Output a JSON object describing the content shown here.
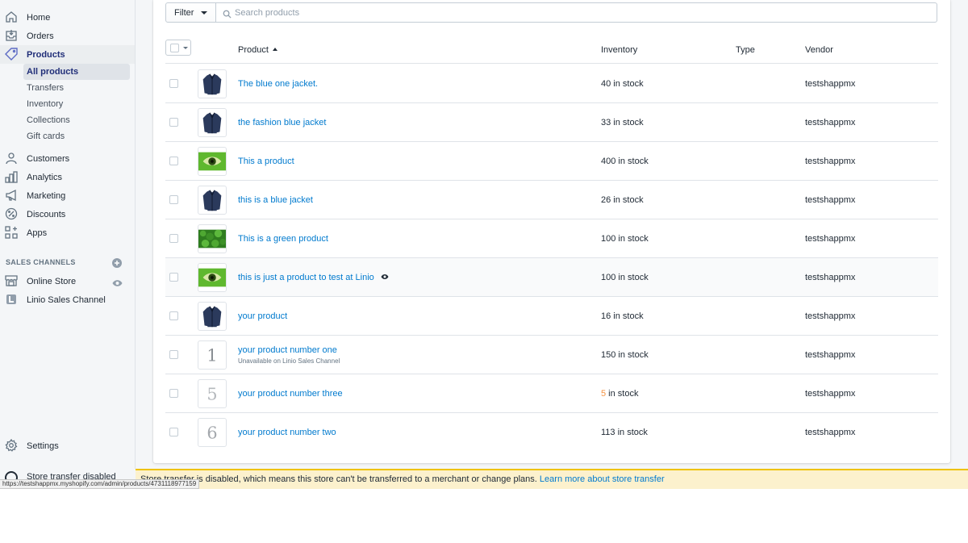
{
  "sidebar": {
    "nav": [
      {
        "label": "Home",
        "icon": "home-icon"
      },
      {
        "label": "Orders",
        "icon": "orders-icon"
      },
      {
        "label": "Products",
        "icon": "tag-icon"
      }
    ],
    "products_sub": [
      {
        "label": "All products"
      },
      {
        "label": "Transfers"
      },
      {
        "label": "Inventory"
      },
      {
        "label": "Collections"
      },
      {
        "label": "Gift cards"
      }
    ],
    "nav2": [
      {
        "label": "Customers",
        "icon": "person-icon"
      },
      {
        "label": "Analytics",
        "icon": "bar-chart-icon"
      },
      {
        "label": "Marketing",
        "icon": "megaphone-icon"
      },
      {
        "label": "Discounts",
        "icon": "discount-icon"
      },
      {
        "label": "Apps",
        "icon": "apps-icon"
      }
    ],
    "sales_channels_heading": "SALES CHANNELS",
    "channels": [
      {
        "label": "Online Store",
        "icon": "store-icon"
      },
      {
        "label": "Linio Sales Channel",
        "icon": "linio-icon"
      }
    ],
    "settings_label": "Settings",
    "store_transfer_label": "Store transfer disabled"
  },
  "toolbar": {
    "filter_label": "Filter",
    "search_placeholder": "Search products"
  },
  "table": {
    "columns": {
      "product": "Product",
      "inventory": "Inventory",
      "type": "Type",
      "vendor": "Vendor"
    },
    "rows": [
      {
        "name": "The blue one jacket.",
        "inventory": "40 in stock",
        "vendor": "testshappmx",
        "thumb": "jacket"
      },
      {
        "name": "the fashion blue jacket",
        "inventory": "33 in stock",
        "vendor": "testshappmx",
        "thumb": "jacket"
      },
      {
        "name": "This a product",
        "inventory": "400 in stock",
        "vendor": "testshappmx",
        "thumb": "eye-green"
      },
      {
        "name": "this is a blue jacket",
        "inventory": "26 in stock",
        "vendor": "testshappmx",
        "thumb": "jacket"
      },
      {
        "name": "This is a green product",
        "inventory": "100 in stock",
        "vendor": "testshappmx",
        "thumb": "leaves"
      },
      {
        "name": "this is just a product to test at Linio",
        "inventory": "100 in stock",
        "vendor": "testshappmx",
        "thumb": "eye-green"
      },
      {
        "name": "your product",
        "inventory": "16 in stock",
        "vendor": "testshappmx",
        "thumb": "jacket"
      },
      {
        "name": "your product number one",
        "note": "Unavailable on Linio Sales Channel",
        "inventory": "150 in stock",
        "vendor": "testshappmx",
        "thumb": "digit-1",
        "digit": "1"
      },
      {
        "name": "your product number three",
        "inventory_count": "5",
        "inventory_suffix": " in stock",
        "vendor": "testshappmx",
        "thumb": "digit-5",
        "digit": "5"
      },
      {
        "name": "your product number two",
        "inventory": "113 in stock",
        "vendor": "testshappmx",
        "thumb": "digit-6",
        "digit": "6"
      }
    ]
  },
  "notice": {
    "text": "Store transfer is disabled, which means this store can't be transferred to a merchant or change plans.",
    "link": "Learn more about store transfer"
  },
  "status_url": "https://testshappmx.myshopify.com/admin/products/4731118977159",
  "colors": {
    "link": "#007ace",
    "low_stock": "#f49342",
    "active_nav": "#202e78",
    "notice_bg": "#fcf1cd"
  }
}
